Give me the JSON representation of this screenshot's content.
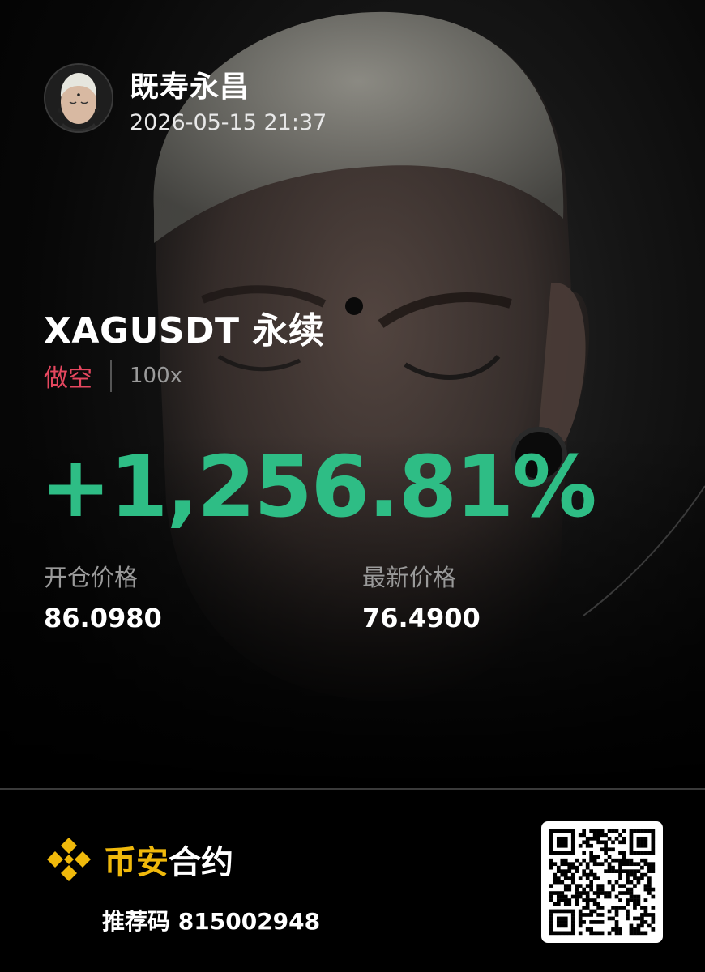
{
  "user": {
    "name": "既寿永昌",
    "timestamp": "2026-05-15 21:37"
  },
  "trade": {
    "symbol": "XAGUSDT 永续",
    "side": "做空",
    "leverage": "100x",
    "pnl_percent": "+1,256.81%",
    "entry_price_label": "开仓价格",
    "entry_price": "86.0980",
    "last_price_label": "最新价格",
    "last_price": "76.4900"
  },
  "footer": {
    "brand_part1": "币安",
    "brand_part2": "合约",
    "referral_label": "推荐码",
    "referral_code": "815002948"
  },
  "colors": {
    "profit": "#2ebd85",
    "short": "#e5475f",
    "brand": "#f0b90b",
    "background": "#000000"
  },
  "icons": [
    "binance-logo-icon",
    "qr-code-icon",
    "avatar-icon"
  ]
}
